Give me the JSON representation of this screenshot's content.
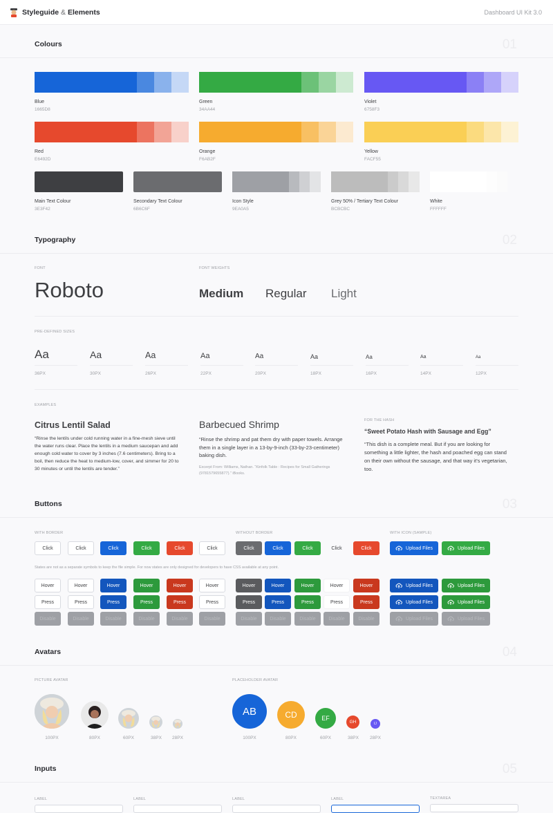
{
  "header": {
    "brand_bold": "Styleguide",
    "brand_amp": "&",
    "brand_rest": "Elements",
    "kit": "Dashboard UI Kit 3.0"
  },
  "sections": {
    "colours": {
      "title": "Colours",
      "num": "01"
    },
    "typography": {
      "title": "Typography",
      "num": "02"
    },
    "buttons": {
      "title": "Buttons",
      "num": "03"
    },
    "avatars": {
      "title": "Avatars",
      "num": "04"
    },
    "inputs": {
      "title": "Inputs",
      "num": "05"
    }
  },
  "colours": {
    "blue": {
      "name": "Blue",
      "hex": "1665D8",
      "shades": [
        "#1665d8",
        "#4a88e0",
        "#8ab2ec",
        "#c5d8f6"
      ]
    },
    "green": {
      "name": "Green",
      "hex": "34AA44",
      "shades": [
        "#34aa44",
        "#6cc178",
        "#9ad5a2",
        "#cdead1"
      ]
    },
    "violet": {
      "name": "Violet",
      "hex": "6758F3",
      "shades": [
        "#6758f3",
        "#8b80f5",
        "#aea7f8",
        "#d6d2fb"
      ]
    },
    "red": {
      "name": "Red",
      "hex": "E6492D",
      "shades": [
        "#e6492d",
        "#ec7460",
        "#f2a496",
        "#f8d1ca"
      ]
    },
    "orange": {
      "name": "Orange",
      "hex": "F6AB2F",
      "shades": [
        "#f6ab2f",
        "#f8c063",
        "#fad497",
        "#fcead0"
      ]
    },
    "yellow": {
      "name": "Yellow",
      "hex": "FACF55",
      "shades": [
        "#facf55",
        "#fbdb7f",
        "#fce6aa",
        "#fdf2d4"
      ]
    },
    "main_text": {
      "name": "Main Text Colour",
      "hex": "3E3F42",
      "shades": [
        "#3e3f42"
      ]
    },
    "secondary_text": {
      "name": "Secondary Text Colour",
      "hex": "6B6C6F",
      "shades": [
        "#6b6c6f"
      ]
    },
    "icon": {
      "name": "Icon Style",
      "hex": "9EA0A5",
      "shades": [
        "#9ea0a5",
        "#b8babe",
        "#cfd0d3",
        "#e3e4e6"
      ]
    },
    "grey": {
      "name": "Grey 50% / Tertiary Text Colour",
      "hex": "BCBCBC",
      "shades": [
        "#bcbcbc",
        "#cbcbcb",
        "#d9d9d9",
        "#e8e8e8"
      ]
    },
    "white": {
      "name": "White",
      "hex": "FFFFFF",
      "shades": [
        "#ffffff",
        "#fdfdfd",
        "#fbfbfb",
        "#f9f9fb"
      ]
    }
  },
  "typography": {
    "font_cap": "Font",
    "font_name": "Roboto",
    "weights_cap": "Font Weights",
    "weights": [
      "Medium",
      "Regular",
      "Light"
    ],
    "sizes_cap": "Pre-defined sizes",
    "sizes": [
      {
        "sample": "Aa",
        "label": "36PX"
      },
      {
        "sample": "Aa",
        "label": "30PX"
      },
      {
        "sample": "Aa",
        "label": "26PX"
      },
      {
        "sample": "Aa",
        "label": "22PX"
      },
      {
        "sample": "Aa",
        "label": "20PX"
      },
      {
        "sample": "Aa",
        "label": "18PX"
      },
      {
        "sample": "Aa",
        "label": "16PX"
      },
      {
        "sample": "Aa",
        "label": "14PX"
      },
      {
        "sample": "Aa",
        "label": "12PX"
      }
    ],
    "examples_cap": "Examples",
    "ex1_title": "Citrus Lentil Salad",
    "ex1_body": "“Rinse the lentils under cold running water in a fine-mesh sieve until the water runs clear. Place the lentils in a medium saucepan and add enough cold water to cover by 3 inches (7.6 centimeters). Bring to a boil, then reduce the heat to medium-low, cover, and simmer for 20 to 30 minutes or until the lentils are tender.”",
    "ex2_title": "Barbecued Shrimp",
    "ex2_body": "“Rinse the shrimp and pat them dry with paper towels. Arrange them in a single layer in a 13-by-9-inch (33-by-23-centimeter) baking dish.",
    "ex2_note": "Excerpt From: Williams, Nathan. “Kinfolk Table : Recipes for Small Gatherings (9781579655877).” iBooks.",
    "ex3_cap": "For the hash",
    "ex3_title": "“Sweet Potato Hash with Sausage and Egg”",
    "ex3_body": "“This dish is a complete meal. But if you are looking for something a little lighter, the hash and poached egg can stand on their own without the sausage, and that way it’s vegetarian, too."
  },
  "buttons": {
    "with_border_cap": "With border",
    "without_border_cap": "Without border",
    "with_icon_cap": "With icon (sample)",
    "click": "Click",
    "hover": "Hover",
    "press": "Press",
    "disable": "Disable",
    "upload": "Upload Files",
    "note": "States are not as a separate symbols to keep the file simple. For now states are only designed for developers to have CSS available at any point."
  },
  "avatars": {
    "picture_cap": "Picture avatar",
    "placeholder_cap": "Placeholder avatar",
    "picture_sizes": [
      "100PX",
      "80PX",
      "60PX",
      "38PX",
      "28PX"
    ],
    "placeholder": [
      {
        "initials": "AB",
        "size": "100PX",
        "color": "#1665d8"
      },
      {
        "initials": "CD",
        "size": "80PX",
        "color": "#f6ab2f"
      },
      {
        "initials": "EF",
        "size": "60PX",
        "color": "#34aa44"
      },
      {
        "initials": "GH",
        "size": "38PX",
        "color": "#e6492d"
      },
      {
        "initials": "IJ",
        "size": "28PX",
        "color": "#6758f3"
      }
    ]
  },
  "inputs": {
    "labels": [
      "Label",
      "Label",
      "Label",
      "Label",
      "Textarea"
    ]
  }
}
